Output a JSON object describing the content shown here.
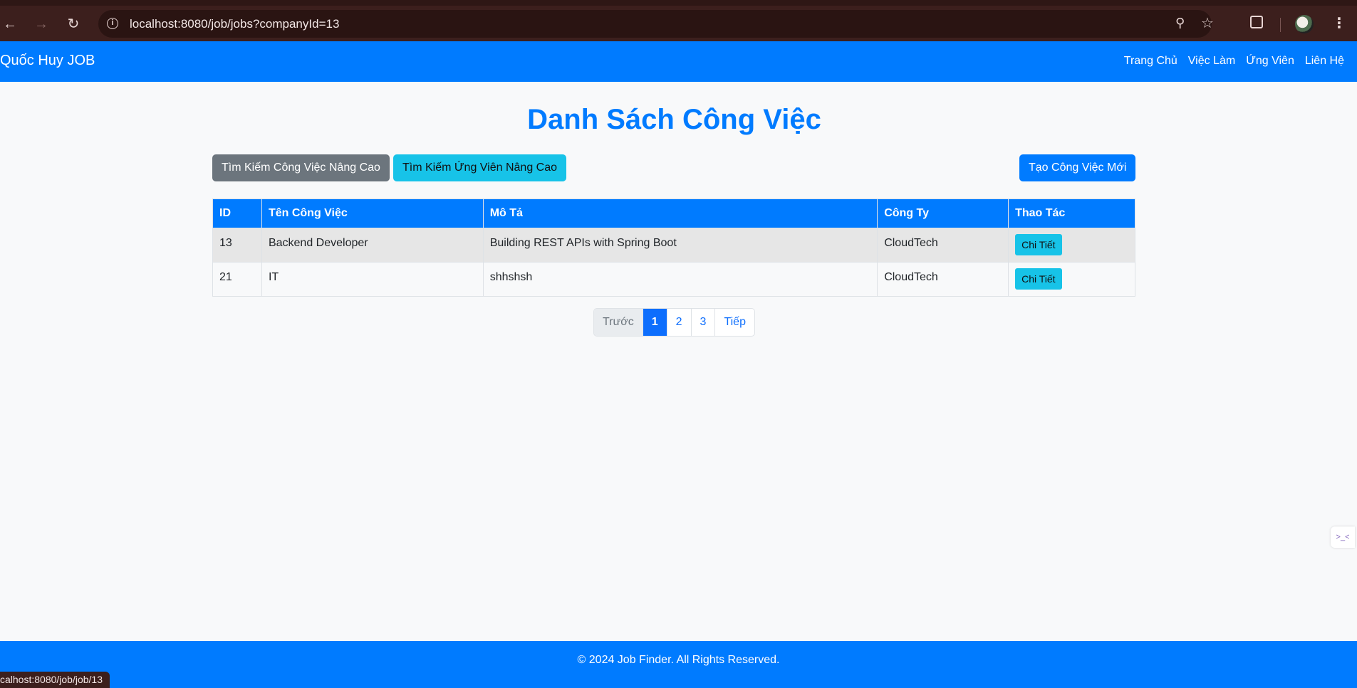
{
  "browser": {
    "url": "localhost:8080/job/jobs?companyId=13",
    "status_url": "calhost:8080/job/job/13"
  },
  "navbar": {
    "brand": "Quốc Huy JOB",
    "links": [
      "Trang Chủ",
      "Việc Làm",
      "Ứng Viên",
      "Liên Hệ"
    ]
  },
  "main": {
    "title": "Danh Sách Công Việc",
    "buttons": {
      "search_jobs": "Tìm Kiếm Công Việc Nâng Cao",
      "search_candidates": "Tìm Kiếm Ứng Viên Nâng Cao",
      "create_job": "Tạo Công Việc Mới"
    },
    "table": {
      "headers": [
        "ID",
        "Tên Công Việc",
        "Mô Tả",
        "Công Ty",
        "Thao Tác"
      ],
      "rows": [
        {
          "id": "13",
          "name": "Backend Developer",
          "description": "Building REST APIs with Spring Boot",
          "company": "CloudTech",
          "action": "Chi Tiết"
        },
        {
          "id": "21",
          "name": "IT",
          "description": "shhshsh",
          "company": "CloudTech",
          "action": "Chi Tiết"
        }
      ]
    },
    "pagination": {
      "prev": "Trước",
      "pages": [
        "1",
        "2",
        "3"
      ],
      "next": "Tiếp",
      "current": "1"
    }
  },
  "footer": {
    "text": "© 2024 Job Finder. All Rights Reserved."
  },
  "colors": {
    "primary": "#007bff",
    "info": "#17c3e8",
    "secondary": "#6c757d"
  }
}
